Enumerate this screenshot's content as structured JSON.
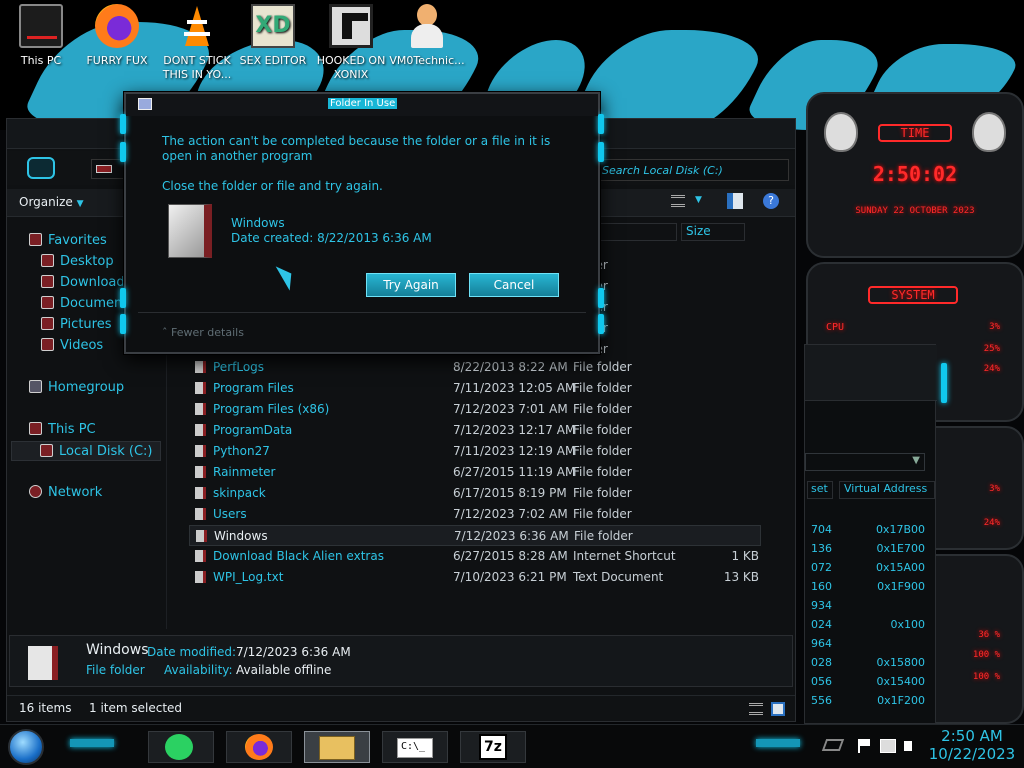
{
  "desktop": {
    "icons": [
      {
        "label": "This PC",
        "icon": "computer-icon"
      },
      {
        "label": "FURRY FUX",
        "icon": "firefox-icon"
      },
      {
        "label": "DONT STICK THIS IN YO...",
        "icon": "vlc-icon"
      },
      {
        "label": "SEX EDITOR",
        "icon": "xd-editor-icon"
      },
      {
        "label": "HOOKED ON XONIX",
        "icon": "game-icon"
      },
      {
        "label": "VM0Technic...",
        "icon": "user-avatar-icon"
      }
    ]
  },
  "explorer": {
    "search_placeholder": "Search Local Disk (C:)",
    "toolbar": {
      "organize": "Organize"
    },
    "columns": {
      "size": "Size"
    },
    "nav": {
      "favorites": "Favorites",
      "desktop": "Desktop",
      "downloads": "Downloads",
      "documents": "Documents",
      "pictures": "Pictures",
      "videos": "Videos",
      "homegroup": "Homegroup",
      "this_pc": "This PC",
      "local_disk": "Local Disk (C:)",
      "network": "Network"
    },
    "partial_rows": [
      "folder",
      "folder",
      "folder",
      "folder",
      "folder"
    ],
    "files": [
      {
        "name": "PerfLogs",
        "date": "8/22/2013 8:22 AM",
        "type": "File folder",
        "size": ""
      },
      {
        "name": "Program Files",
        "date": "7/11/2023 12:05 AM",
        "type": "File folder",
        "size": ""
      },
      {
        "name": "Program Files (x86)",
        "date": "7/12/2023 7:01 AM",
        "type": "File folder",
        "size": ""
      },
      {
        "name": "ProgramData",
        "date": "7/12/2023 12:17 AM",
        "type": "File folder",
        "size": ""
      },
      {
        "name": "Python27",
        "date": "7/11/2023 12:19 AM",
        "type": "File folder",
        "size": ""
      },
      {
        "name": "Rainmeter",
        "date": "6/27/2015 11:19 AM",
        "type": "File folder",
        "size": ""
      },
      {
        "name": "skinpack",
        "date": "6/17/2015 8:19 PM",
        "type": "File folder",
        "size": ""
      },
      {
        "name": "Users",
        "date": "7/12/2023 7:02 AM",
        "type": "File folder",
        "size": ""
      },
      {
        "name": "Windows",
        "date": "7/12/2023 6:36 AM",
        "type": "File folder",
        "size": ""
      },
      {
        "name": "Download Black Alien extras",
        "date": "6/27/2015 8:28 AM",
        "type": "Internet Shortcut",
        "size": "1 KB"
      },
      {
        "name": "WPI_Log.txt",
        "date": "7/10/2023 6:21 PM",
        "type": "Text Document",
        "size": "13 KB"
      }
    ],
    "details": {
      "name": "Windows",
      "date_modified_label": "Date modified:",
      "date_modified": "7/12/2023 6:36 AM",
      "type": "File folder",
      "availability_label": "Availability:",
      "availability": "Available offline"
    },
    "status": {
      "items": "16 items",
      "selected": "1 item selected"
    }
  },
  "dialog": {
    "title": "Folder In Use",
    "message": "The action can't be completed because the folder or a file in it is open in another program",
    "instruction": "Close the folder or file and try again.",
    "item_name": "Windows",
    "item_date": "Date created: 8/22/2013 6:36 AM",
    "try_again": "Try Again",
    "cancel": "Cancel",
    "fewer_details": "Fewer details"
  },
  "gadgets": {
    "time_title": "TIME",
    "time": "2:50:02",
    "date": "SUNDAY 22 OCTOBER 2023",
    "system_title": "SYSTEM",
    "cpu_label": "CPU",
    "values_1": [
      "3%",
      "25%",
      "24%"
    ],
    "values_2": [
      "3%",
      "24%"
    ],
    "values_3": [
      "36 %",
      "100 %",
      "100 %"
    ]
  },
  "process_window": {
    "col_offset": "set",
    "col_virtual": "Virtual Address",
    "rows": [
      {
        "a": "704",
        "b": "0x17B00"
      },
      {
        "a": "136",
        "b": "0x1E700"
      },
      {
        "a": "072",
        "b": "0x15A00"
      },
      {
        "a": "160",
        "b": "0x1F900"
      },
      {
        "a": "934",
        "b": ""
      },
      {
        "a": "024",
        "b": "0x100"
      },
      {
        "a": "964",
        "b": ""
      },
      {
        "a": "028",
        "b": "0x15800"
      },
      {
        "a": "056",
        "b": "0x15400"
      },
      {
        "a": "556",
        "b": "0x1F200"
      }
    ]
  },
  "taskbar": {
    "time": "2:50 AM",
    "date": "10/22/2023",
    "cmd_label": "C:\\_",
    "zip_label": "7z"
  },
  "colors": {
    "accent": "#2ec4e6",
    "alarm": "#ff2a2a",
    "button": "#1f9fbb"
  }
}
